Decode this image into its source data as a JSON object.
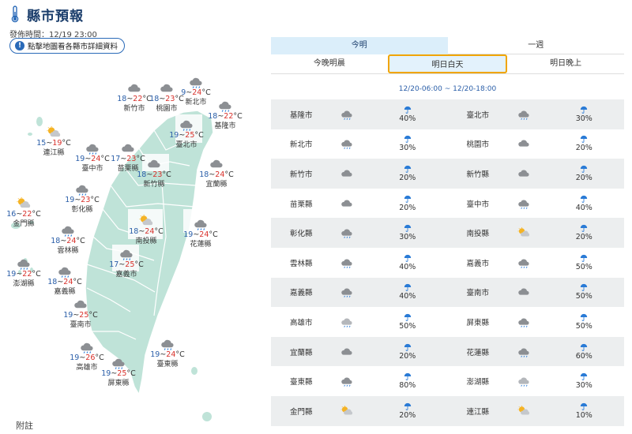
{
  "header": {
    "title": "縣市預報",
    "published": "發佈時間：12/19 23:00",
    "hint": "點擊地圖看各縣市詳細資料"
  },
  "tabs_top": [
    "今明",
    "一週"
  ],
  "tabs_sub": [
    "今晚明晨",
    "明日白天",
    "明日晚上"
  ],
  "period": "12/20-06:00 ~ 12/20-18:00",
  "annotation": "附註",
  "colors": {
    "accent": "#2a6ab8",
    "map_land": "#bfe3d8",
    "selected_border": "#f0a500",
    "low_temp": "#2a5ea8",
    "high_temp": "#d8302a"
  },
  "map_labels": [
    {
      "name": "連江縣",
      "lo": "15",
      "hi": "19",
      "icon": "sun-cloud"
    },
    {
      "name": "臺中市",
      "lo": "19",
      "hi": "24",
      "icon": "cloud-rain"
    },
    {
      "name": "新竹市",
      "lo": "18",
      "hi": "22",
      "icon": "cloud"
    },
    {
      "name": "桃園市",
      "lo": "18",
      "hi": "23",
      "icon": "cloud"
    },
    {
      "name": "新北市",
      "lo": "9",
      "hi": "24",
      "icon": "cloud-rain"
    },
    {
      "name": "基隆市",
      "lo": "18",
      "hi": "22",
      "icon": "cloud-rain"
    },
    {
      "name": "臺北市",
      "lo": "19",
      "hi": "25",
      "icon": "cloud-rain"
    },
    {
      "name": "苗栗縣",
      "lo": "17",
      "hi": "23",
      "icon": "cloud"
    },
    {
      "name": "新竹縣",
      "lo": "18",
      "hi": "23",
      "icon": "cloud"
    },
    {
      "name": "宜蘭縣",
      "lo": "18",
      "hi": "24",
      "icon": "cloud"
    },
    {
      "name": "彰化縣",
      "lo": "19",
      "hi": "23",
      "icon": "cloud-rain"
    },
    {
      "name": "金門縣",
      "lo": "16",
      "hi": "22",
      "icon": "sun-cloud"
    },
    {
      "name": "南投縣",
      "lo": "18",
      "hi": "24",
      "icon": "sun-cloud"
    },
    {
      "name": "花蓮縣",
      "lo": "19",
      "hi": "24",
      "icon": "cloud-rain"
    },
    {
      "name": "雲林縣",
      "lo": "18",
      "hi": "24",
      "icon": "cloud-rain"
    },
    {
      "name": "嘉義市",
      "lo": "17",
      "hi": "25",
      "icon": "cloud-rain"
    },
    {
      "name": "嘉義縣",
      "lo": "18",
      "hi": "24",
      "icon": "cloud-rain"
    },
    {
      "name": "澎湖縣",
      "lo": "19",
      "hi": "22",
      "icon": "cloud-rain"
    },
    {
      "name": "臺南市",
      "lo": "19",
      "hi": "25",
      "icon": "cloud"
    },
    {
      "name": "高雄市",
      "lo": "19",
      "hi": "26",
      "icon": "cloud-rain"
    },
    {
      "name": "屏東縣",
      "lo": "19",
      "hi": "25",
      "icon": "cloud-rain"
    },
    {
      "name": "臺東縣",
      "lo": "19",
      "hi": "24",
      "icon": "cloud-rain"
    }
  ],
  "table": [
    [
      {
        "name": "基隆市",
        "pop": "40%",
        "icon": "cloud-rain"
      },
      {
        "name": "臺北市",
        "pop": "30%",
        "icon": "cloud-rain"
      }
    ],
    [
      {
        "name": "新北市",
        "pop": "30%",
        "icon": "cloud-rain"
      },
      {
        "name": "桃園市",
        "pop": "20%",
        "icon": "cloud"
      }
    ],
    [
      {
        "name": "新竹市",
        "pop": "20%",
        "icon": "cloud"
      },
      {
        "name": "新竹縣",
        "pop": "20%",
        "icon": "cloud"
      }
    ],
    [
      {
        "name": "苗栗縣",
        "pop": "20%",
        "icon": "cloud"
      },
      {
        "name": "臺中市",
        "pop": "40%",
        "icon": "cloud-rain"
      }
    ],
    [
      {
        "name": "彰化縣",
        "pop": "30%",
        "icon": "cloud-rain"
      },
      {
        "name": "南投縣",
        "pop": "20%",
        "icon": "sun-cloud"
      }
    ],
    [
      {
        "name": "雲林縣",
        "pop": "40%",
        "icon": "cloud-rain"
      },
      {
        "name": "嘉義市",
        "pop": "50%",
        "icon": "cloud-rain"
      }
    ],
    [
      {
        "name": "嘉義縣",
        "pop": "40%",
        "icon": "cloud-rain"
      },
      {
        "name": "臺南市",
        "pop": "50%",
        "icon": "cloud"
      }
    ],
    [
      {
        "name": "高雄市",
        "pop": "50%",
        "icon": "cloud-rain-light"
      },
      {
        "name": "屏東縣",
        "pop": "50%",
        "icon": "cloud-rain"
      }
    ],
    [
      {
        "name": "宜蘭縣",
        "pop": "20%",
        "icon": "cloud"
      },
      {
        "name": "花蓮縣",
        "pop": "60%",
        "icon": "cloud-rain"
      }
    ],
    [
      {
        "name": "臺東縣",
        "pop": "80%",
        "icon": "cloud-rain"
      },
      {
        "name": "澎湖縣",
        "pop": "30%",
        "icon": "cloud-rain-light"
      }
    ],
    [
      {
        "name": "金門縣",
        "pop": "20%",
        "icon": "sun-cloud"
      },
      {
        "name": "連江縣",
        "pop": "10%",
        "icon": "sun-cloud"
      }
    ]
  ]
}
